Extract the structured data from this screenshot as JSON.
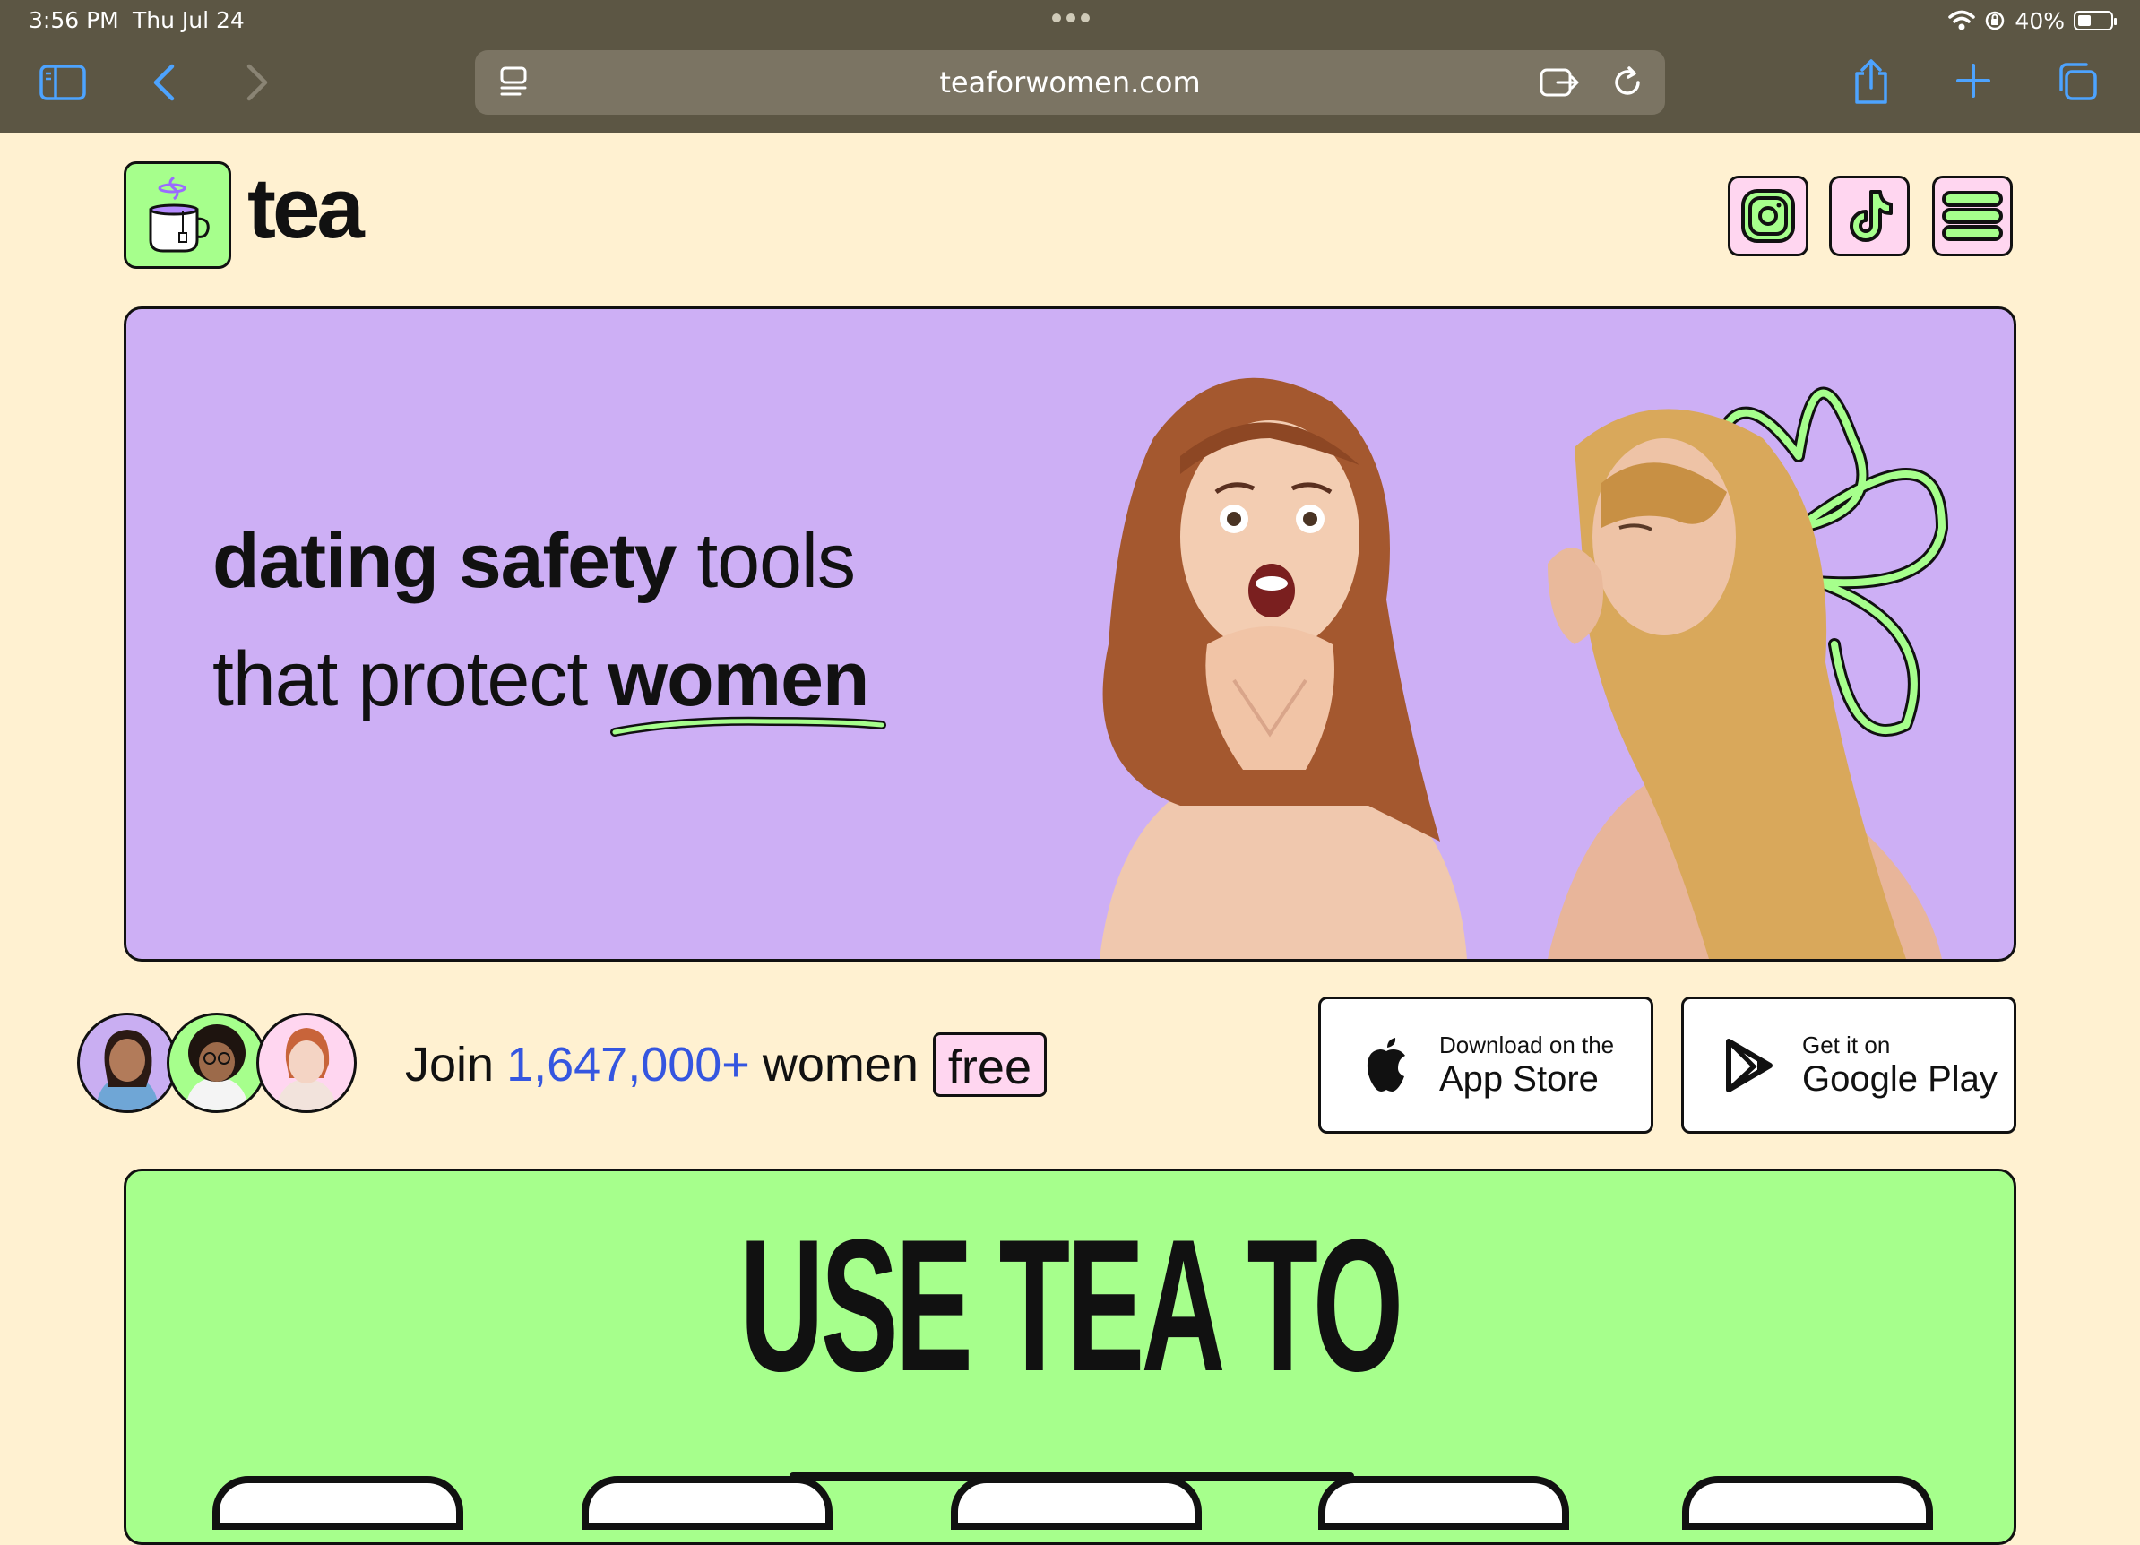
{
  "status_bar": {
    "time": "3:56 PM",
    "date": "Thu Jul 24",
    "battery": "40%"
  },
  "browser": {
    "url": "teaforwomen.com",
    "icons": [
      "sidebar-icon",
      "back-icon",
      "forward-icon",
      "page-menu-icon",
      "reader-icon",
      "reload-icon",
      "share-icon",
      "new-tab-icon",
      "tabs-icon"
    ]
  },
  "header": {
    "logo_text": "tea",
    "social": [
      "instagram-icon",
      "tiktok-icon",
      "menu-icon"
    ]
  },
  "hero": {
    "line1_bold": "dating safety",
    "line1_rest": "tools",
    "line2_rest": "that protect",
    "line2_bold": "women"
  },
  "join": {
    "prefix": "Join",
    "count": "1,647,000+",
    "suffix": "women",
    "badge": "free"
  },
  "stores": {
    "apple": {
      "small": "Download on the",
      "big": "App Store"
    },
    "google": {
      "small": "Get it on",
      "big": "Google Play"
    }
  },
  "section": {
    "headline": "USE TEA TO"
  },
  "colors": {
    "page_bg": "#fff1d1",
    "hero_bg": "#cdaff5",
    "green": "#a6ff8c",
    "pink": "#ffd6f0",
    "count_blue": "#3556e0",
    "chrome": "#5c5644"
  }
}
